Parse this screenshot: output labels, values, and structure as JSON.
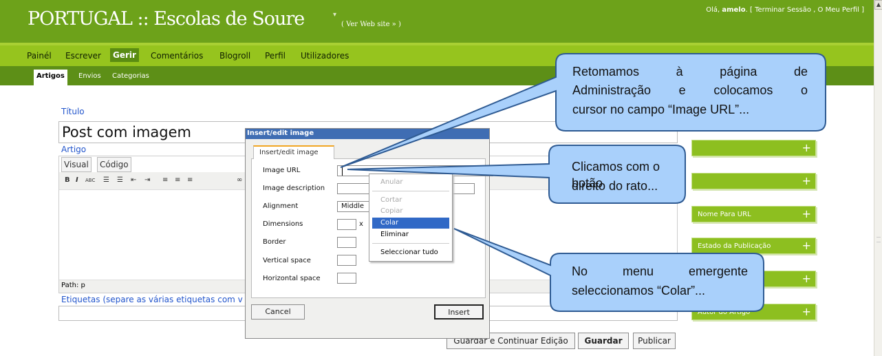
{
  "header": {
    "site_title": "PORTUGAL :: Escolas de Soure",
    "title_caret": "▾",
    "view_site": "( Ver Web site » )",
    "greeting": "Olá,",
    "username": "amelo",
    "user_links": ". [ Terminar Sessão , O Meu Perfil ]"
  },
  "nav": {
    "items": [
      "Painél",
      "Escrever",
      "Gerir",
      "Comentários",
      "Blogroll",
      "Perfil",
      "Utilizadores"
    ],
    "active": "Gerir"
  },
  "subnav": {
    "items": [
      "Artigos",
      "Envios",
      "Categorias"
    ],
    "active": "Artigos"
  },
  "post": {
    "title_label": "Título",
    "title_value": "Post com imagem",
    "body_label": "Artigo",
    "tab_visual": "Visual",
    "tab_code": "Código",
    "toolbar": [
      "B",
      "I",
      "ABC",
      "☰",
      "☰",
      "⇤",
      "⇥",
      "≡",
      "≡",
      "≡",
      "∞"
    ],
    "path": "Path: p",
    "tags_label": "Etiquetas (separe as várias etiquetas com v"
  },
  "buttons": {
    "save_continue": "Guardar e Continuar Edição",
    "save": "Guardar",
    "publish": "Publicar"
  },
  "sidebar": {
    "boxes": [
      "",
      "",
      "Nome Para URL",
      "Estado da Publicação",
      "",
      "Autor do Artigo"
    ],
    "plus": "+"
  },
  "dialog": {
    "title": "Insert/edit image",
    "tab": "Insert/edit image",
    "fields": {
      "image_url": "Image URL",
      "image_description": "Image description",
      "alignment": "Alignment",
      "dimensions": "Dimensions",
      "border": "Border",
      "vertical_space": "Vertical space",
      "horizontal_space": "Horizontal space"
    },
    "alignment_value": "Middle",
    "dim_separator": "x",
    "cancel": "Cancel",
    "insert": "Insert"
  },
  "context_menu": {
    "items": [
      "Anular",
      "Cortar",
      "Copiar",
      "Colar",
      "Eliminar",
      "Seleccionar tudo"
    ],
    "selected": "Colar"
  },
  "callouts": {
    "c1_line1": "Retomamos à página de",
    "c1_line2": "Administração e colocamos o",
    "c1_line3": "cursor no campo “Image URL”...",
    "c2_line1": "Clicamos com o botão",
    "c2_line2": "direito do rato...",
    "c3_line1": "No menu emergente",
    "c3_line2": "seleccionamos “Colar”..."
  },
  "colors": {
    "header_bg": "#6da21a",
    "nav_bg": "#96c41e",
    "subnav_bg": "#5d8f17",
    "dialog_title_bg": "#3f6db3",
    "menu_highlight": "#3169c6",
    "callout_fill": "#a9d0fb",
    "callout_stroke": "#2e5a92"
  },
  "scrollbar": {
    "up_arrow": "▲"
  }
}
